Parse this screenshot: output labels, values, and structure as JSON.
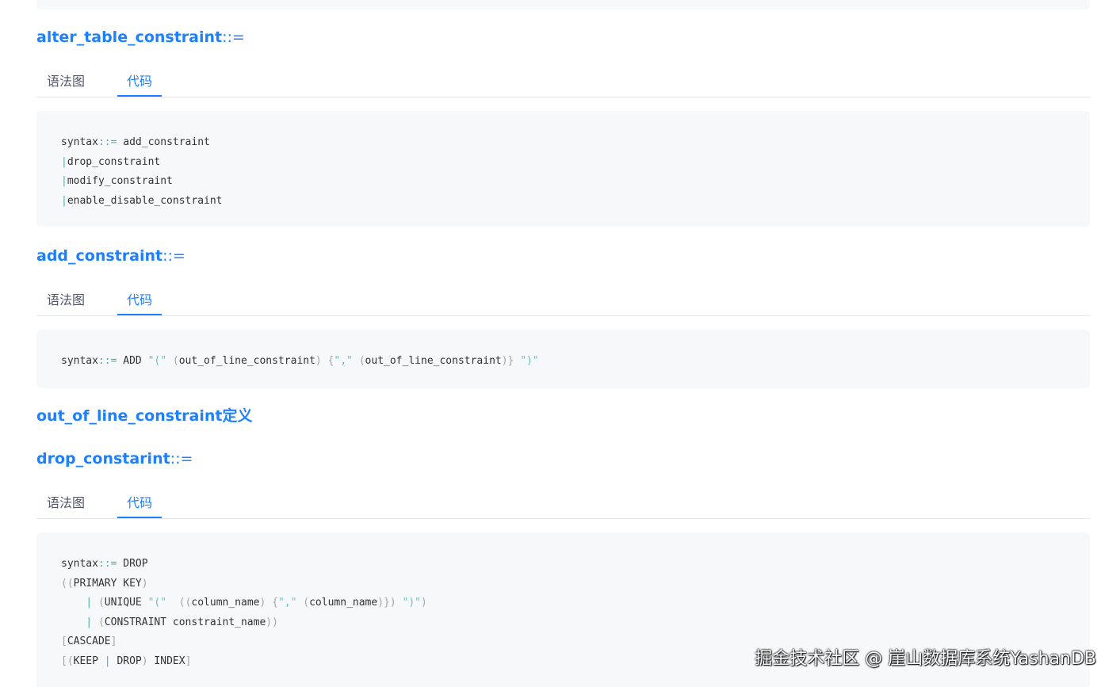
{
  "tabs": {
    "diagram": "语法图",
    "code": "代码"
  },
  "sections": [
    {
      "name": "alter_table_constraint",
      "op": "::="
    },
    {
      "name": "add_constraint",
      "op": "::="
    },
    {
      "name": "out_of_line_constraint定义",
      "op": ""
    },
    {
      "name": "drop_constarint",
      "op": "::="
    }
  ],
  "code": {
    "alter": {
      "l1_a": "syntax",
      "l1_op": "::=",
      "l1_b": " add_constraint",
      "l2_bar": "|",
      "l2_t": "drop_constraint",
      "l3_bar": "|",
      "l3_t": "modify_constraint",
      "l4_bar": "|",
      "l4_t": "enable_disable_constraint"
    },
    "add": {
      "a": "syntax",
      "op": "::=",
      "b": " ADD ",
      "s1": "\"(\"",
      "p1": " (",
      "t1": "out_of_line_constraint",
      "p2": ") {",
      "s2": "\",\"",
      "p3": " (",
      "t2": "out_of_line_constraint",
      "p4": ")} ",
      "s3": "\")\""
    },
    "drop": {
      "l1_a": "syntax",
      "l1_op": "::=",
      "l1_b": " DROP",
      "l2_p": "((",
      "l2_t": "PRIMARY KEY",
      "l2_p2": ")",
      "l3_ind": "    ",
      "l3_bar": "|",
      "l3_p": " (",
      "l3_t": "UNIQUE ",
      "l3_s1": "\"(\"",
      "l3_p2": "  ((",
      "l3_t2": "column_name",
      "l3_p3": ") {",
      "l3_s2": "\",\"",
      "l3_p4": " (",
      "l3_t3": "column_name",
      "l3_p5": ")}) ",
      "l3_s3": "\")\"",
      "l3_p6": ")",
      "l4_ind": "    ",
      "l4_bar": "|",
      "l4_p": " (",
      "l4_t": "CONSTRAINT constraint_name",
      "l4_p2": "))",
      "l5_p": "[",
      "l5_t": "CASCADE",
      "l5_p2": "]",
      "l6_p": "[(",
      "l6_t": "KEEP ",
      "l6_bar": "|",
      "l6_t2": " DROP",
      "l6_p2": ") ",
      "l6_t3": "INDEX",
      "l6_p3": "]"
    }
  },
  "watermark": "掘金技术社区 @ 崖山数据库系统YashanDB"
}
